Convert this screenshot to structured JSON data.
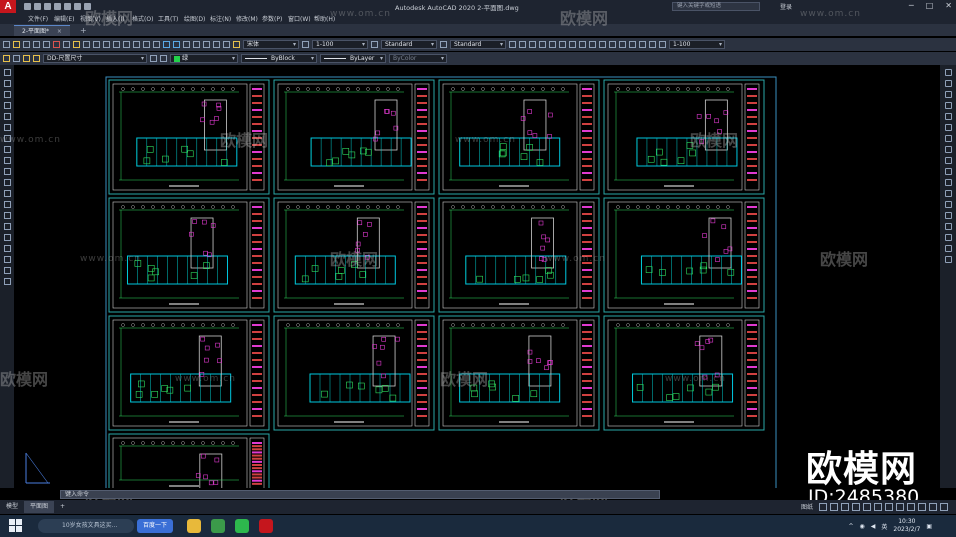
{
  "titlebar": {
    "app_logo": "A",
    "title": "Autodesk AutoCAD 2020    2-平面图.dwg",
    "search_placeholder": "键入关键字或短语",
    "login": "登录",
    "minimize": "─",
    "maximize": "□",
    "close": "✕"
  },
  "menu": [
    "文件(F)",
    "编辑(E)",
    "视图(V)",
    "插入(I)",
    "格式(O)",
    "工具(T)",
    "绘图(D)",
    "标注(N)",
    "修改(M)",
    "参数(P)",
    "窗口(W)",
    "帮助(H)"
  ],
  "tabs": {
    "active_doc": "2-平面图*",
    "close": "×",
    "add": "+"
  },
  "toolbar1": {
    "text_style": "宋体",
    "dim_scale": "1-100",
    "dim_style": "Standard",
    "table_style": "Standard",
    "mleader_scale": "1-100"
  },
  "toolbar2": {
    "layer": "DD-尺置尺寸",
    "color": "绿",
    "linetype": "ByBlock",
    "lineweight": "ByLayer",
    "plotstyle": "ByColor",
    "color_hex": "#22d14a"
  },
  "command_placeholder": "键入命令",
  "layout_tabs": [
    "模型",
    "平面图"
  ],
  "status": {
    "label": "图纸"
  },
  "watermarks": {
    "brand": "欧模网",
    "url": "www.om.cn",
    "big_brand": "欧模网",
    "id": "ID:2485380"
  },
  "taskbar": {
    "search_placeholder": "10岁女孩文具这买...",
    "search_button": "百度一下",
    "ime": "英",
    "time": "10:30",
    "date": "2023/2/7"
  }
}
